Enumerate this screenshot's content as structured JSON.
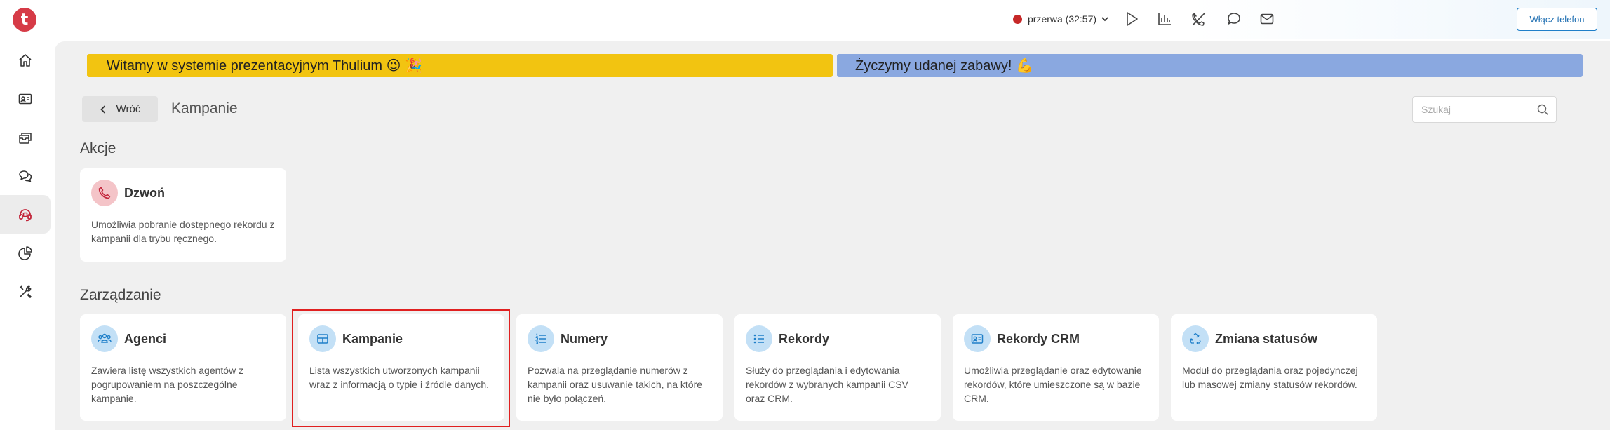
{
  "topbar": {
    "logo_letter": "t",
    "status_text": "przerwa (32:57)",
    "status_color": "#c62828",
    "phone_button_label": "Włącz telefon",
    "icons": [
      "play-icon",
      "stats-icon",
      "phone-off-icon",
      "chat-icon",
      "mail-icon"
    ]
  },
  "sidebar": {
    "items": [
      {
        "icon": "home-icon"
      },
      {
        "icon": "contact-card-icon"
      },
      {
        "icon": "inbox-icon"
      },
      {
        "icon": "chat-icon"
      },
      {
        "icon": "campaign-headset-icon",
        "active": true
      },
      {
        "icon": "pie-chart-icon"
      },
      {
        "icon": "tools-icon"
      }
    ]
  },
  "banners": {
    "welcome": "Witamy w systemie prezentacyjnym Thulium 😉 🎉",
    "wish": "Życzymy udanej zabawy! 💪"
  },
  "header": {
    "back_label": "Wróć",
    "page_title": "Kampanie",
    "search_placeholder": "Szukaj"
  },
  "sections": {
    "actions_title": "Akcje",
    "management_title": "Zarządzanie"
  },
  "actions": [
    {
      "title": "Dzwoń",
      "desc": "Umożliwia pobranie dostępnego rekordu z kampanii dla trybu ręcznego.",
      "icon": "phone-icon"
    }
  ],
  "management": [
    {
      "title": "Agenci",
      "desc": "Zawiera listę wszystkich agentów z pogrupowaniem na poszczególne kampanie.",
      "icon": "users-icon"
    },
    {
      "title": "Kampanie",
      "desc": "Lista wszystkich utworzonych kampanii wraz z informacją o typie i źródle danych.",
      "icon": "table-icon"
    },
    {
      "title": "Numery",
      "desc": "Pozwala na przeglądanie numerów z kampanii oraz usuwanie takich, na które nie było połączeń.",
      "icon": "numbered-list-icon"
    },
    {
      "title": "Rekordy",
      "desc": "Służy do przeglądania i edytowania rekordów z wybranych kampanii CSV oraz CRM.",
      "icon": "list-icon"
    },
    {
      "title": "Rekordy CRM",
      "desc": "Umożliwia przeglądanie oraz edytowanie rekordów, które umieszczone są w bazie CRM.",
      "icon": "id-card-icon"
    },
    {
      "title": "Zmiana statusów",
      "desc": "Moduł do przeglądania oraz pojedynczej lub masowej zmiany statusów rekordów.",
      "icon": "recycle-icon"
    }
  ],
  "colors": {
    "accent": "#1f7fc9",
    "banner_yellow": "#f2c411",
    "banner_blue": "#8aa8e0",
    "highlight": "#e02020"
  }
}
